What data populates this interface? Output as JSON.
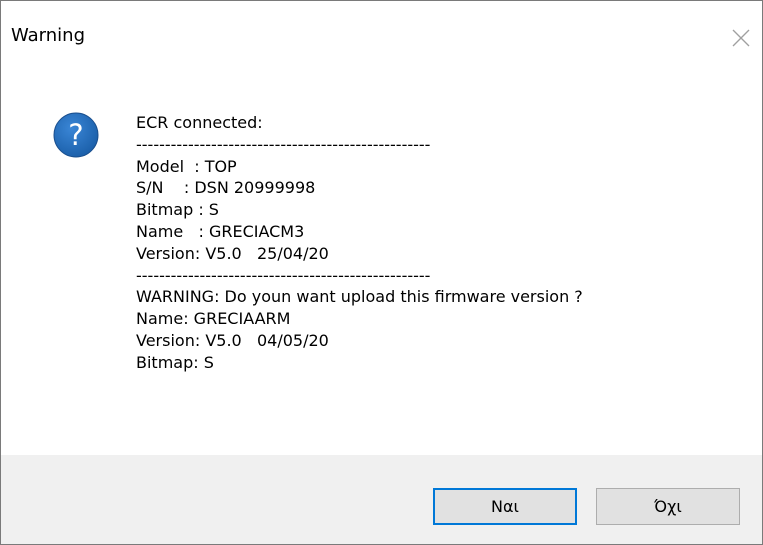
{
  "dialog": {
    "title": "Warning",
    "message_lines": [
      "ECR connected:",
      "---------------------------------------------------",
      "Model  : TOP",
      "S/N    : DSN 20999998",
      "Bitmap : S",
      "Name   : GRECIACM3",
      "Version: V5.0   25/04/20",
      "---------------------------------------------------",
      "WARNING: Do youn want upload this firmware version ?",
      "Name: GRECIAARM",
      "Version: V5.0   04/05/20",
      "Bitmap: S"
    ],
    "buttons": {
      "yes_label": "Ναι",
      "no_label": "Όχι"
    }
  },
  "colors": {
    "icon_blue": "#1a66b8",
    "default_button_border": "#0078d7",
    "footer_bg": "#f0f0f0"
  }
}
